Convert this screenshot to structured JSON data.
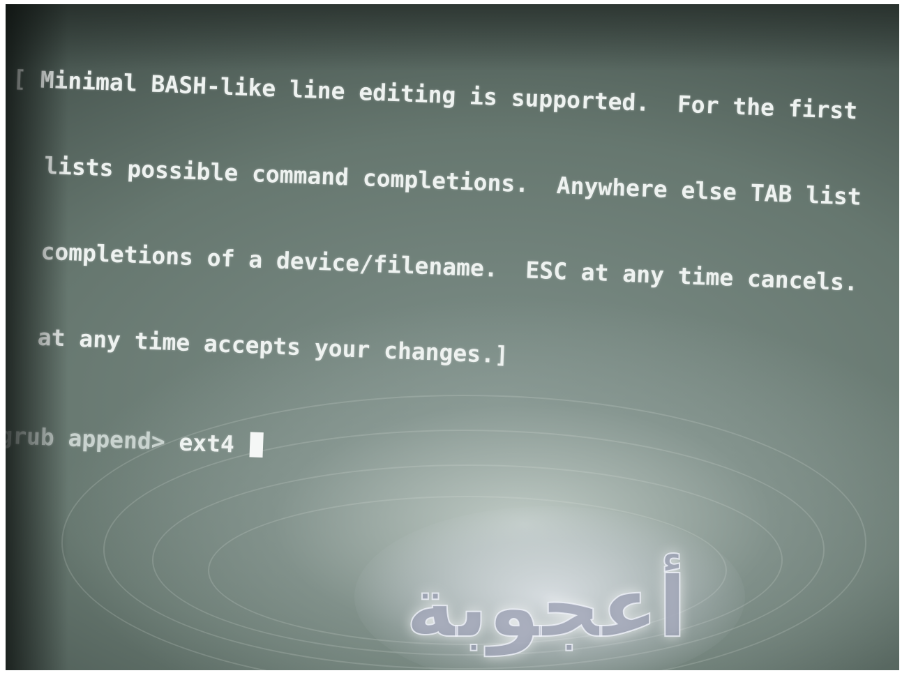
{
  "terminal": {
    "help_lines": [
      "[ Minimal BASH-like line editing is supported.  For the first",
      "lists possible command completions.  Anywhere else TAB list",
      "completions of a device/filename.  ESC at any time cancels.",
      "at any time accepts your changes.]"
    ],
    "prompt_label": "grub append>",
    "command_input": "ext4"
  },
  "logo": {
    "text": "أعجوبة",
    "icon": "watermark-logo"
  },
  "colors": {
    "screen_background": "#6f807a",
    "terminal_text": "#eef2f0",
    "cursor": "#f5f7f6"
  }
}
